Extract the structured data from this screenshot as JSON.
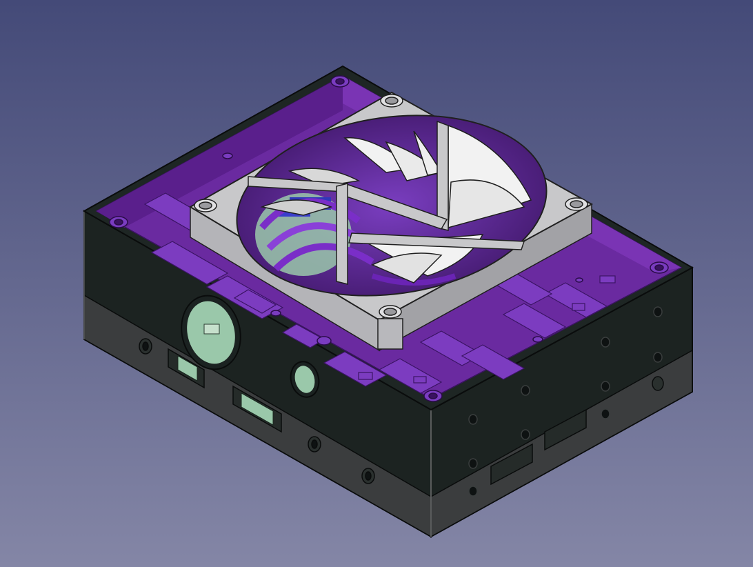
{
  "viewport": {
    "background_top": "#444a78",
    "background_bottom": "#8486a6"
  },
  "model": {
    "case_color": "#1a2220",
    "case_lower_color": "#3a3c3d",
    "interior_color": "#6a2aa0",
    "interior_dark": "#4e1b7a",
    "rim_color": "#8a3ed0",
    "fan_frame_color": "#c6c6c8",
    "fan_blade_color": "#f2f2f2",
    "pcb_green": "#9ac8aa",
    "component_blue": "#3038b8"
  }
}
